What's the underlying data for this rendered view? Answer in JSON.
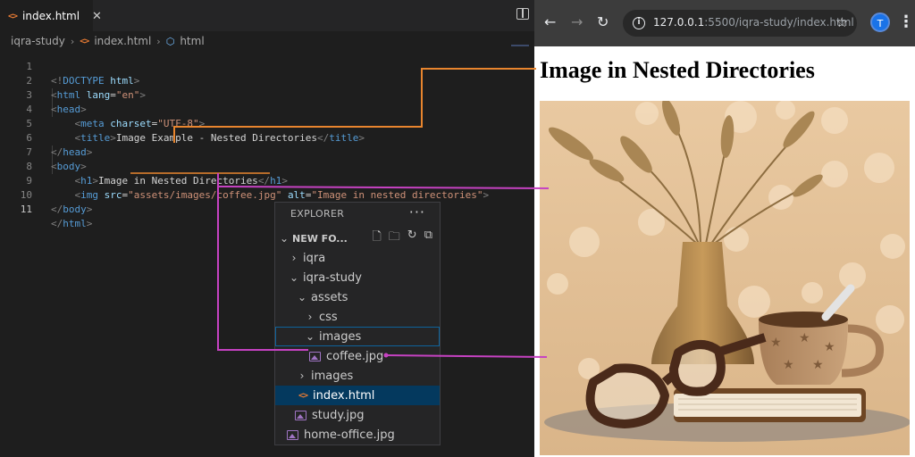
{
  "editor": {
    "tab": {
      "icon": "html-file-icon",
      "label": "index.html",
      "close": "✕"
    },
    "breadcrumb": [
      "iqra-study",
      "index.html",
      "html"
    ],
    "line_numbers": [
      "1",
      "2",
      "3",
      "4",
      "5",
      "6",
      "7",
      "8",
      "9",
      "10",
      "11"
    ],
    "code": {
      "l1": {
        "open": "<!",
        "doctype": "DOCTYPE",
        "html": "html",
        "close": ">"
      },
      "l2": {
        "open": "<",
        "tag": "html",
        "attr": "lang",
        "eq": "=",
        "val": "\"en\"",
        "close": ">"
      },
      "l3": {
        "open": "<",
        "tag": "head",
        "close": ">"
      },
      "l4": {
        "open": "<",
        "tag": "meta",
        "attr": "charset",
        "eq": "=",
        "val": "\"UTF-8\"",
        "close": ">"
      },
      "l5": {
        "open": "<",
        "tag": "title",
        "close": ">",
        "text": "Image Example - Nested Directories",
        "end_open": "</",
        "end_tag": "title",
        "end_close": ">"
      },
      "l6": {
        "open": "</",
        "tag": "head",
        "close": ">"
      },
      "l7": {
        "open": "<",
        "tag": "body",
        "close": ">"
      },
      "l8": {
        "open": "<",
        "tag": "h1",
        "close": ">",
        "text": "Image in Nested Directories",
        "end_open": "</",
        "end_tag": "h1",
        "end_close": ">"
      },
      "l9": {
        "open": "<",
        "tag": "img",
        "attr1": "src",
        "eq": "=",
        "val1": "\"assets/images/coffee.jpg\"",
        "attr2": "alt",
        "val2": "\"Image in nested directories\"",
        "close": ">"
      },
      "l10": {
        "open": "</",
        "tag": "body",
        "close": ">"
      },
      "l11": {
        "open": "</",
        "tag": "html",
        "close": ">"
      }
    }
  },
  "explorer": {
    "title": "EXPLORER",
    "more": "···",
    "root": "NEW FO...",
    "items": [
      {
        "label": "iqra",
        "type": "folder",
        "state": "collapsed"
      },
      {
        "label": "iqra-study",
        "type": "folder",
        "state": "expanded"
      },
      {
        "label": "assets",
        "type": "folder",
        "state": "expanded"
      },
      {
        "label": "css",
        "type": "folder",
        "state": "collapsed"
      },
      {
        "label": "images",
        "type": "folder",
        "state": "expanded"
      },
      {
        "label": "coffee.jpg",
        "type": "image"
      },
      {
        "label": "images",
        "type": "folder",
        "state": "collapsed"
      },
      {
        "label": "index.html",
        "type": "html",
        "selected": true
      },
      {
        "label": "study.jpg",
        "type": "image"
      },
      {
        "label": "home-office.jpg",
        "type": "image"
      }
    ]
  },
  "browser": {
    "url_host": "127.0.0.1",
    "url_path": ":5500/iqra-study/index.html",
    "profile_initial": "T",
    "page_heading": "Image in Nested Directories"
  },
  "colors": {
    "connector_orange": "#e8852e",
    "connector_magenta": "#c642c2",
    "accent_blue": "#1a73e8"
  }
}
